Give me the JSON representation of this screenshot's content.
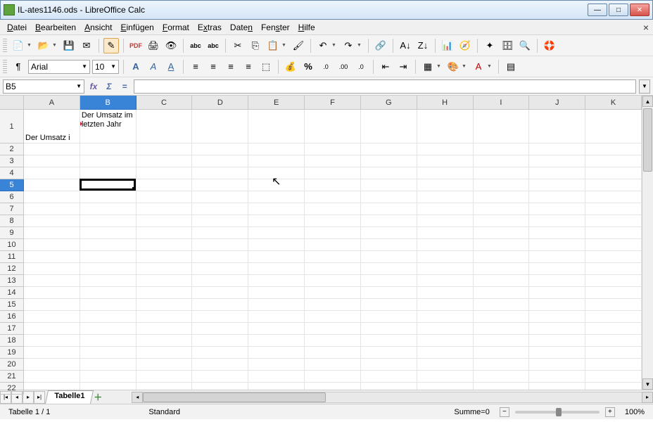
{
  "title": "IL-ates1146.ods - LibreOffice Calc",
  "menu": [
    "Datei",
    "Bearbeiten",
    "Ansicht",
    "Einfügen",
    "Format",
    "Extras",
    "Daten",
    "Fenster",
    "Hilfe"
  ],
  "font": {
    "name": "Arial",
    "size": "10"
  },
  "namebox": "B5",
  "formula": "",
  "columns": [
    "A",
    "B",
    "C",
    "D",
    "E",
    "F",
    "G",
    "H",
    "I",
    "J",
    "K"
  ],
  "selected_col": "B",
  "rows": [
    "1",
    "2",
    "3",
    "4",
    "5",
    "6",
    "7",
    "8",
    "9",
    "10",
    "11",
    "12",
    "13",
    "14",
    "15",
    "16",
    "17",
    "18",
    "19",
    "20",
    "21",
    "22"
  ],
  "selected_row": "5",
  "cells": {
    "A1": "Der Umsatz i",
    "B1": "Der Umsatz im letzten Jahr"
  },
  "sheet_tab": "Tabelle1",
  "status": {
    "sheet": "Tabelle 1 / 1",
    "style": "Standard",
    "sum": "Summe=0",
    "zoom": "100%"
  }
}
